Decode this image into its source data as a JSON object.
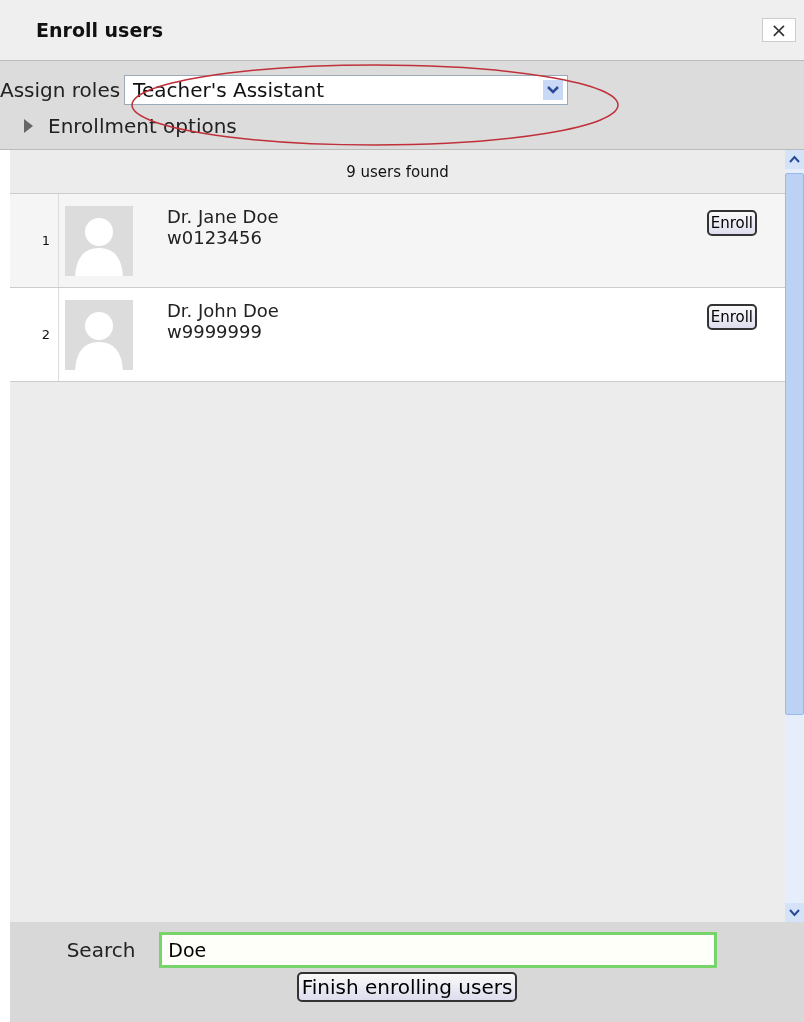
{
  "window": {
    "title": "Enroll users",
    "close": "×"
  },
  "assign_roles": {
    "label": "Assign roles",
    "value": "Teacher's Assistant"
  },
  "enrollment_options": {
    "label": "Enrollment options",
    "expanded": false
  },
  "results": {
    "count": "9 users found"
  },
  "users": [
    {
      "index": "1",
      "name": "Dr. Jane Doe",
      "id": "w0123456",
      "button": "Enroll"
    },
    {
      "index": "2",
      "name": "Dr. John Doe",
      "id": "w9999999",
      "button": "Enroll"
    }
  ],
  "search": {
    "label": "Search",
    "value": "Doe"
  },
  "finish_button": "Finish enrolling users"
}
